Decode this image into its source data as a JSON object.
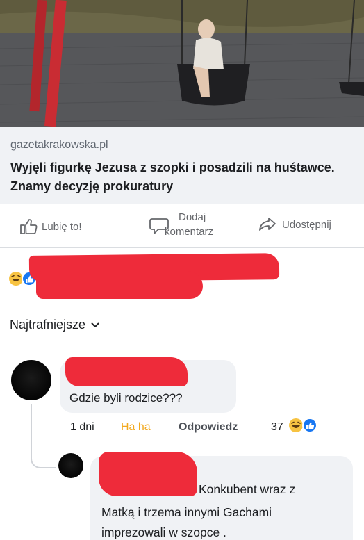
{
  "post": {
    "link": {
      "domain": "gazetakrakowska.pl",
      "headline": "Wyjęli figurkę Jezusa z szopki i posadzili na huśtawce. Znamy decyzję prokuratury"
    },
    "actions": {
      "like_label": "Lubię to!",
      "comment_label_line1": "Dodaj",
      "comment_label_line2": "komentarz",
      "share_label": "Udostępnij"
    },
    "reaction_icons": [
      "haha-icon",
      "like-icon"
    ]
  },
  "comments": {
    "sort_label": "Najtrafniejsze",
    "first": {
      "text": "Gdzie byli rodzice???",
      "time": "1 dni",
      "reaction_label": "Ha ha",
      "reply_label": "Odpowiedz",
      "reaction_count": "37"
    },
    "reply": {
      "line1": "Konkubent wraz z",
      "line2": "Matką i trzema innymi Gachami",
      "line3": "imprezowali w  szopce ."
    }
  },
  "colors": {
    "redaction": "#ee2b3a",
    "haha": "#f2a91f",
    "like_blue": "#1877f2",
    "link_bg": "#f0f2f5"
  }
}
